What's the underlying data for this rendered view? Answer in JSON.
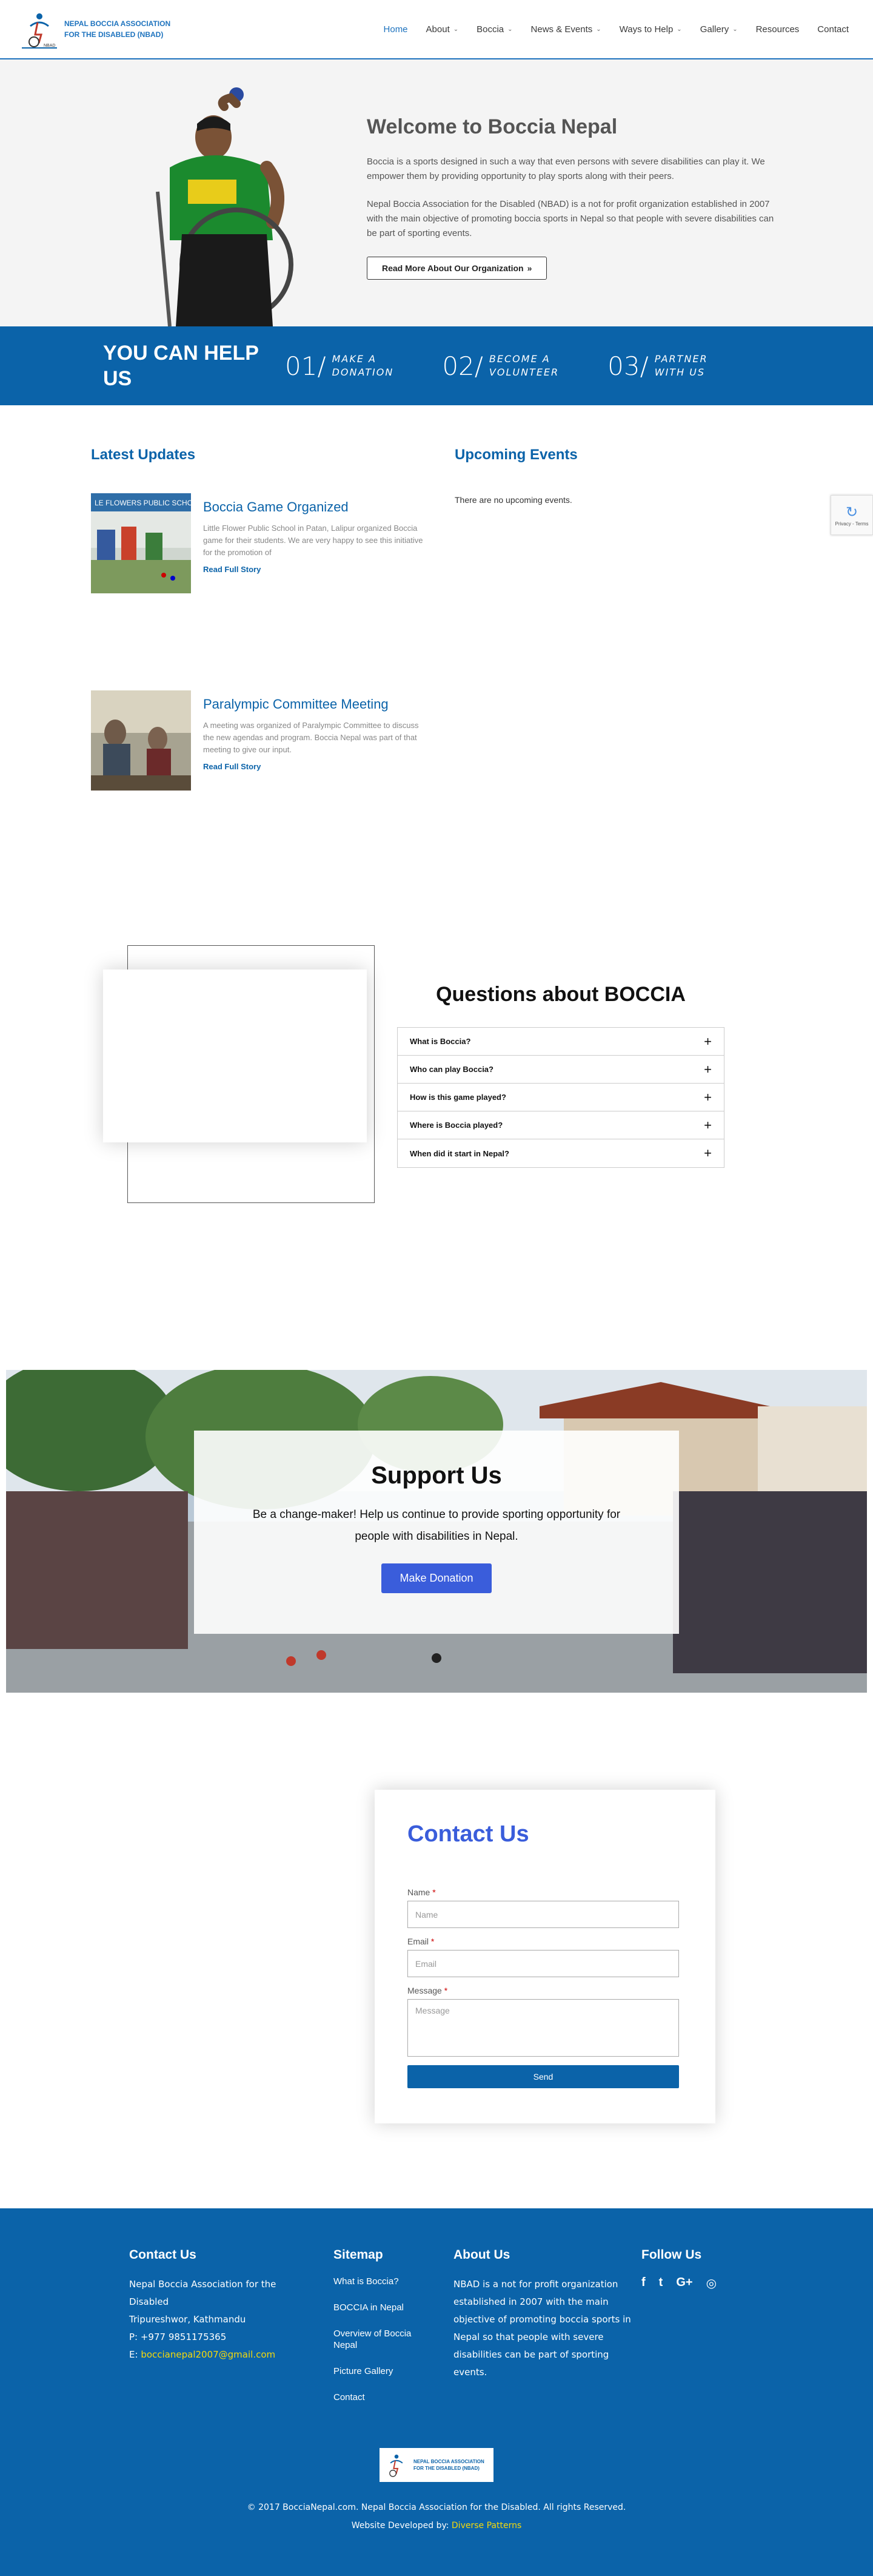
{
  "header": {
    "logo_line1": "Nepal Boccia Association",
    "logo_line2": "for the Disabled (NBAD)",
    "nav": [
      {
        "label": "Home",
        "active": true,
        "dropdown": false
      },
      {
        "label": "About",
        "active": false,
        "dropdown": true
      },
      {
        "label": "Boccia",
        "active": false,
        "dropdown": true
      },
      {
        "label": "News & Events",
        "active": false,
        "dropdown": true
      },
      {
        "label": "Ways to Help",
        "active": false,
        "dropdown": true
      },
      {
        "label": "Gallery",
        "active": false,
        "dropdown": true
      },
      {
        "label": "Resources",
        "active": false,
        "dropdown": false
      },
      {
        "label": "Contact",
        "active": false,
        "dropdown": false
      }
    ]
  },
  "hero": {
    "title": "Welcome to Boccia Nepal",
    "p1": "Boccia is a sports designed in such a way that even persons with severe disabilities can play it. We empower them by providing opportunity to play sports along with their peers.",
    "p2": "Nepal Boccia Association for the Disabled (NBAD) is a not for profit organization established in 2007 with the main objective of promoting boccia sports in Nepal so that people with severe disabilities can be part of sporting events.",
    "button": "Read More About Our Organization"
  },
  "help": {
    "title": "YOU CAN HELP US",
    "items": [
      {
        "num": "01/",
        "line1": "Make a",
        "line2": "Donation"
      },
      {
        "num": "02/",
        "line1": "Become a",
        "line2": "Volunteer"
      },
      {
        "num": "03/",
        "line1": "Partner",
        "line2": "with us"
      }
    ]
  },
  "updates": {
    "heading": "Latest Updates",
    "posts": [
      {
        "title": "Boccia Game Organized",
        "excerpt": "Little Flower Public School in Patan, Lalipur organized Boccia game for their students. We are very happy to see this initiative for the promotion of",
        "link": "Read Full Story",
        "img_text": "LE FLOWERS PUBLIC SCHOOL"
      },
      {
        "title": "Paralympic Committee Meeting",
        "excerpt": "A meeting was organized of Paralympic Committee to discuss the new agendas and program. Boccia Nepal was part of that meeting to give our input.",
        "link": "Read Full Story"
      }
    ]
  },
  "events": {
    "heading": "Upcoming Events",
    "empty": "There are no upcoming events.",
    "recaptcha": "Privacy - Terms"
  },
  "faq": {
    "title": "Questions about BOCCIA",
    "items": [
      "What is Boccia?",
      "Who can play Boccia?",
      "How is this game played?",
      "Where is Boccia played?",
      "When did it start in Nepal?"
    ]
  },
  "support": {
    "title": "Support Us",
    "text": "Be a change-maker! Help us continue to provide sporting opportunity for people with disabilities in Nepal.",
    "button": "Make Donation"
  },
  "contact": {
    "title": "Contact Us",
    "name_label": "Name",
    "name_placeholder": "Name",
    "email_label": "Email",
    "email_placeholder": "Email",
    "message_label": "Message",
    "message_placeholder": "Message",
    "required": "*",
    "send": "Send"
  },
  "footer": {
    "contact_heading": "Contact Us",
    "org": "Nepal Boccia Association for the Disabled",
    "address": "Tripureshwor, Kathmandu",
    "phone": "P: +977 9851175365",
    "email_prefix": "E: ",
    "email": "boccianepal2007@gmail.com",
    "sitemap_heading": "Sitemap",
    "sitemap": [
      "What is Boccia?",
      "BOCCIA in Nepal",
      "Overview of Boccia Nepal",
      "Picture Gallery",
      "Contact"
    ],
    "about_heading": "About Us",
    "about": "NBAD is a not for profit organization established in 2007 with the main objective of promoting boccia sports in Nepal so that people with severe disabilities can be part of sporting events.",
    "follow_heading": "Follow Us",
    "social": [
      {
        "name": "facebook-icon",
        "glyph": "f"
      },
      {
        "name": "twitter-icon",
        "glyph": "t"
      },
      {
        "name": "google-plus-icon",
        "glyph": "G+"
      },
      {
        "name": "instagram-icon",
        "glyph": "◎"
      }
    ],
    "copyright": "© 2017 BocciaNepal.com. Nepal Boccia Association for the Disabled. All rights Reserved.",
    "developed_prefix": "Website Developed by: ",
    "developer": "Diverse Patterns"
  },
  "colors": {
    "brand_blue": "#0b63a9",
    "accent_blue": "#3a5ddb",
    "link_yellow": "#f5d90a"
  }
}
